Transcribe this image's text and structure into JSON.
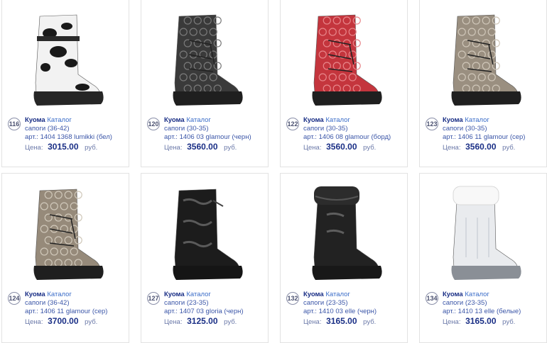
{
  "products": [
    {
      "num": "116",
      "brand": "Куома",
      "catalog": "Каталог",
      "type": "сапоги",
      "size": "(36-42)",
      "art_label": "арт.:",
      "art": "1404 1368 lumikki (бел)",
      "price_label": "Цена:",
      "price": "3015.00",
      "currency": "руб.",
      "palette": {
        "shaft": "#f2f2f2",
        "pattern": "#1a1a1a",
        "sole": "#262626"
      },
      "style": "cow"
    },
    {
      "num": "120",
      "brand": "Куома",
      "catalog": "Каталог",
      "type": "сапоги",
      "size": "(30-35)",
      "art_label": "арт.:",
      "art": "1406 03 glamour (черн)",
      "price_label": "Цена:",
      "price": "3560.00",
      "currency": "руб.",
      "palette": {
        "shaft": "#3a3a3a",
        "pattern": "#7a7a7a",
        "sole": "#1f1f1f"
      },
      "style": "quilt"
    },
    {
      "num": "122",
      "brand": "Куома",
      "catalog": "Каталог",
      "type": "сапоги",
      "size": "(30-35)",
      "art_label": "арт.:",
      "art": "1406 08 glamour (борд)",
      "price_label": "Цена:",
      "price": "3560.00",
      "currency": "руб.",
      "palette": {
        "shaft": "#c4353d",
        "pattern": "#e7868a",
        "sole": "#1f1f1f"
      },
      "style": "quilt"
    },
    {
      "num": "123",
      "brand": "Куома",
      "catalog": "Каталог",
      "type": "сапоги",
      "size": "(30-35)",
      "art_label": "арт.:",
      "art": "1406 11 glamour (сер)",
      "price_label": "Цена:",
      "price": "3560.00",
      "currency": "руб.",
      "palette": {
        "shaft": "#9a8f80",
        "pattern": "#cfc6b8",
        "sole": "#1f1f1f"
      },
      "style": "quilt"
    },
    {
      "num": "124",
      "brand": "Куома",
      "catalog": "Каталог",
      "type": "сапоги",
      "size": "(36-42)",
      "art_label": "арт.:",
      "art": "1406 11 glamour (сер)",
      "price_label": "Цена:",
      "price": "3700.00",
      "currency": "руб.",
      "palette": {
        "shaft": "#968a7a",
        "pattern": "#d0c8ba",
        "sole": "#1f1f1f"
      },
      "style": "quilt"
    },
    {
      "num": "127",
      "brand": "Куома",
      "catalog": "Каталог",
      "type": "сапоги",
      "size": "(23-35)",
      "art_label": "арт.:",
      "art": "1407 03 gloria (черн)",
      "price_label": "Цена:",
      "price": "3125.00",
      "currency": "руб.",
      "palette": {
        "shaft": "#1c1c1c",
        "pattern": "#5a5a5a",
        "sole": "#151515"
      },
      "style": "gloss"
    },
    {
      "num": "132",
      "brand": "Куома",
      "catalog": "Каталог",
      "type": "сапоги",
      "size": "(23-35)",
      "art_label": "арт.:",
      "art": "1410 03 elle (черн)",
      "price_label": "Цена:",
      "price": "3165.00",
      "currency": "руб.",
      "palette": {
        "shaft": "#222222",
        "pattern": "#5e5e5e",
        "sole": "#181818"
      },
      "style": "fur"
    },
    {
      "num": "134",
      "brand": "Куома",
      "catalog": "Каталог",
      "type": "сапоги",
      "size": "(23-35)",
      "art_label": "арт.:",
      "art": "1410 13 elle (белые)",
      "price_label": "Цена:",
      "price": "3165.00",
      "currency": "руб.",
      "palette": {
        "shaft": "#e9ebee",
        "pattern": "#c7ccd3",
        "sole": "#8a8f96"
      },
      "style": "whitefur"
    }
  ]
}
